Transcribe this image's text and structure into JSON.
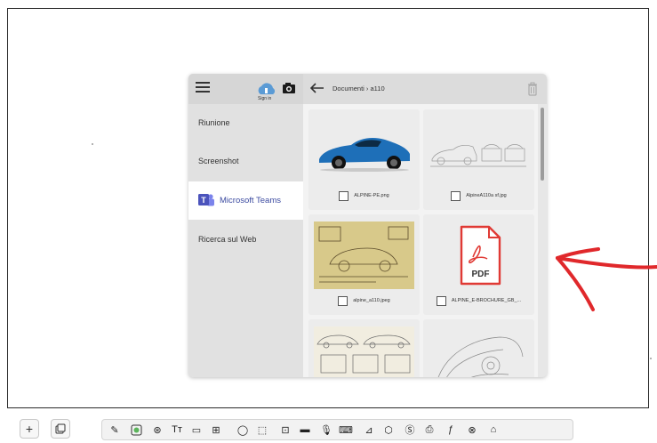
{
  "sidebar": {
    "signin_label": "Sign in",
    "items": [
      {
        "label": "Riunione"
      },
      {
        "label": "Screenshot"
      },
      {
        "label": "Microsoft Teams"
      },
      {
        "label": "Ricerca sul Web"
      }
    ]
  },
  "header": {
    "breadcrumb": "Documenti › a110"
  },
  "files": [
    {
      "name": "ALPINE-PE.png"
    },
    {
      "name": "AlpineA110a sf.jpg"
    },
    {
      "name": "alpine_a110.jpeg"
    },
    {
      "name": "ALPINE_E-BROCHURE_GB_..."
    },
    {
      "name": ""
    },
    {
      "name": ""
    }
  ],
  "pdf_label": "PDF",
  "colors": {
    "accent": "#3b4aa0",
    "pdf_red": "#e03a35",
    "annotation_red": "#e0282b"
  },
  "toolbar": {
    "add_label": "+",
    "tools": [
      "pen-icon",
      "highlighter-icon",
      "shape-icon",
      "text-icon",
      "page-icon",
      "insert-icon",
      "lasso-icon",
      "select-icon",
      "capture-icon",
      "media-icon",
      "mic-icon",
      "keyboard-icon",
      "ruler-icon",
      "eraser-icon",
      "s-icon",
      "print-icon",
      "function-icon",
      "close-icon",
      "home-icon"
    ]
  }
}
